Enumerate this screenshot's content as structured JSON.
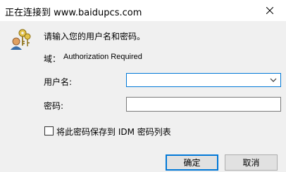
{
  "window": {
    "title": "正在连接到 www.baidupcs.com"
  },
  "dialog": {
    "prompt": "请输入您的用户名和密码。",
    "domain_label": "域：",
    "domain_value": "Authorization Required",
    "username_label": "用户名:",
    "username_value": "",
    "password_label": "密码:",
    "password_value": "",
    "remember_label": "将此密码保存到 IDM 密码列表",
    "remember_checked": false
  },
  "buttons": {
    "ok_label": "确定",
    "cancel_label": "取消"
  },
  "icons": {
    "title_close": "close-icon",
    "credentials": "keys-icon",
    "dropdown": "chevron-down-icon"
  },
  "colors": {
    "focus_border": "#0078d7",
    "dialog_bg": "#f0f0f0"
  }
}
